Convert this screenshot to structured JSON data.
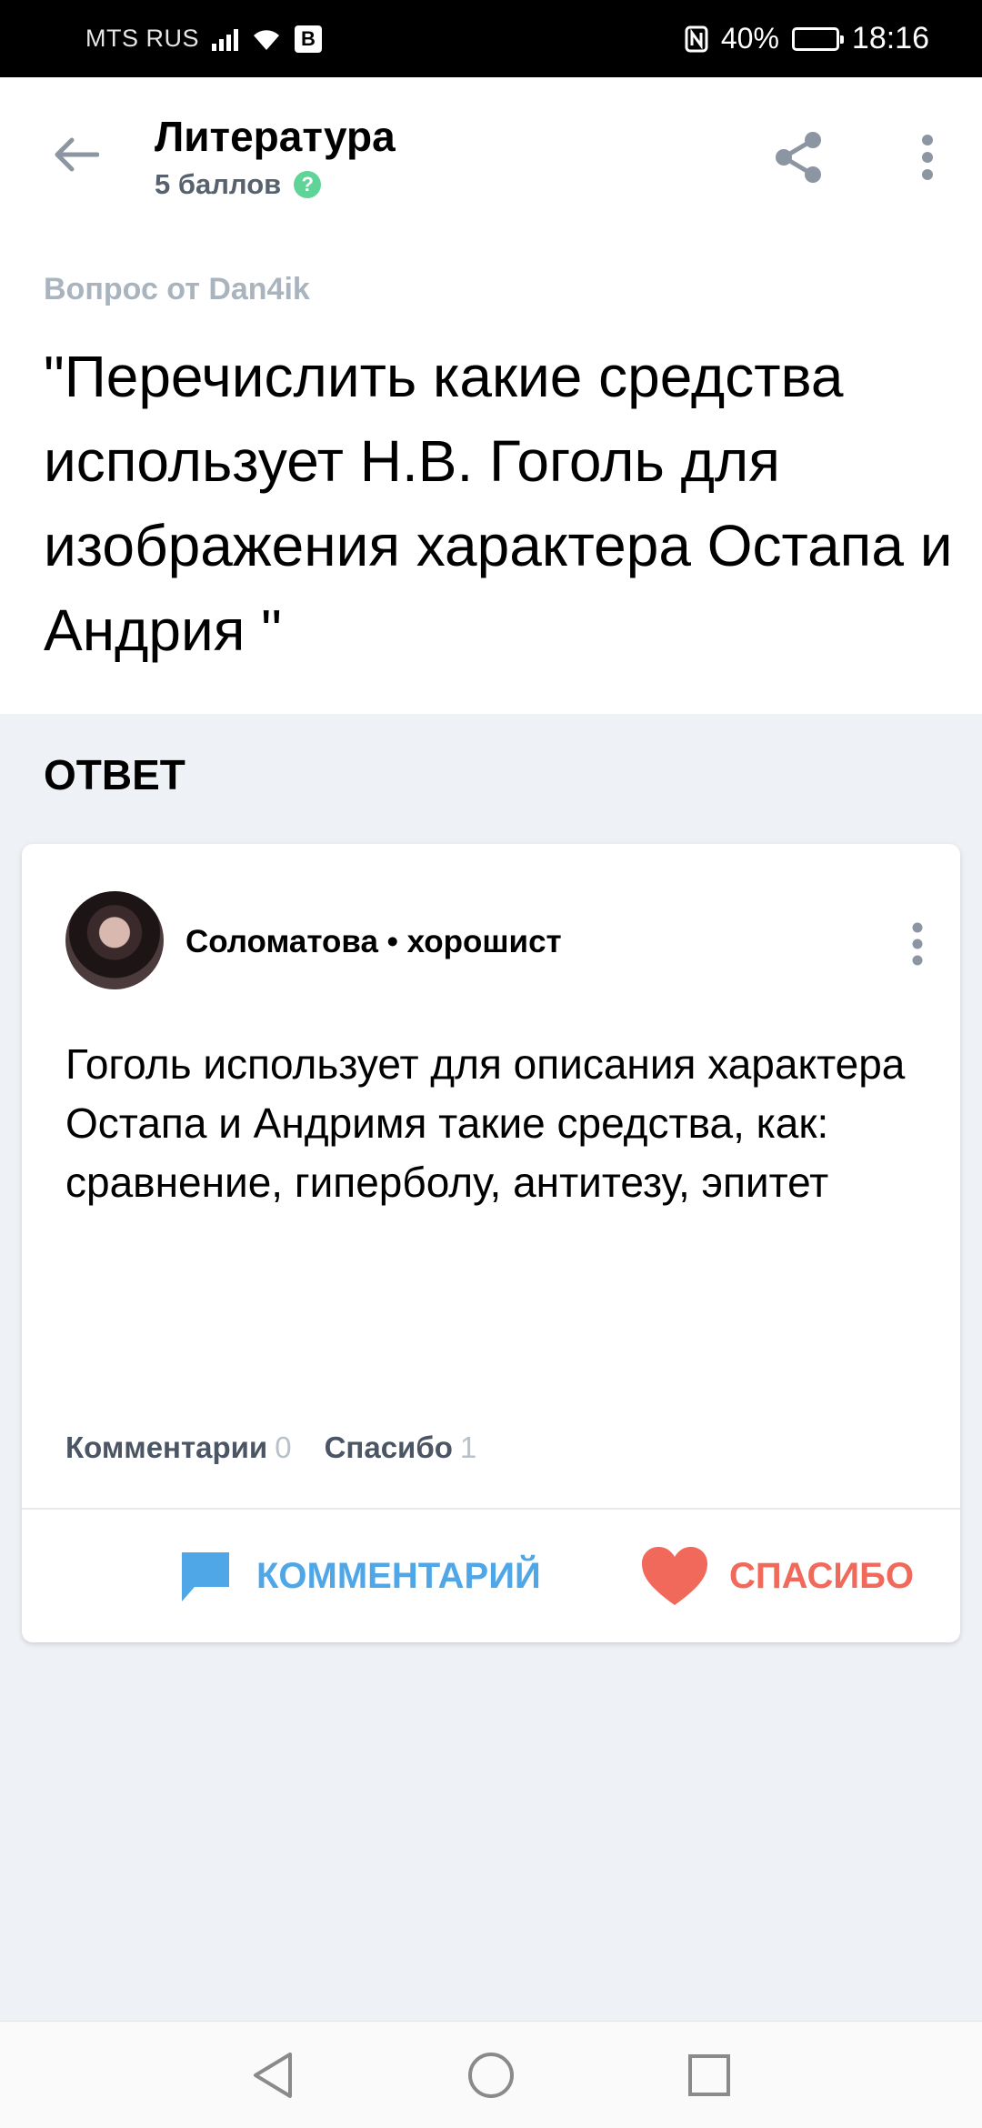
{
  "status_bar": {
    "carrier": "MTS RUS",
    "battery_percent": "40%",
    "battery_level": 0.4,
    "time": "18:16"
  },
  "header": {
    "title": "Литература",
    "points": "5 баллов",
    "help_symbol": "?"
  },
  "question": {
    "meta": "Вопрос от Dan4ik",
    "text": "\"Перечислить какие средства использует Н.В. Гоголь для изображения характера Остапа и Андрия \""
  },
  "answer_section": {
    "label": "ОТВЕТ"
  },
  "answer": {
    "author": "Соломатова • хорошист",
    "text": "Гоголь использует для описания характера Остапа и Андримя такие средства, как: сравнение, гиперболу, антитезу, эпитет",
    "comments_label": "Комментарии",
    "comments_count": "0",
    "thanks_label": "Спасибо",
    "thanks_count": "1",
    "comment_button": "КОММЕНТАРИЙ",
    "thanks_button": "СПАСИБО"
  },
  "colors": {
    "accent_blue": "#4fa7e8",
    "accent_red": "#f0695a",
    "help_green": "#60d399"
  },
  "icons": {
    "back": "arrow-left-icon",
    "share": "share-icon",
    "more": "more-vertical-icon",
    "comment": "comment-bubble-icon",
    "thanks": "heart-icon",
    "nav_back": "triangle-back-icon",
    "nav_home": "circle-home-icon",
    "nav_recents": "square-recents-icon"
  }
}
